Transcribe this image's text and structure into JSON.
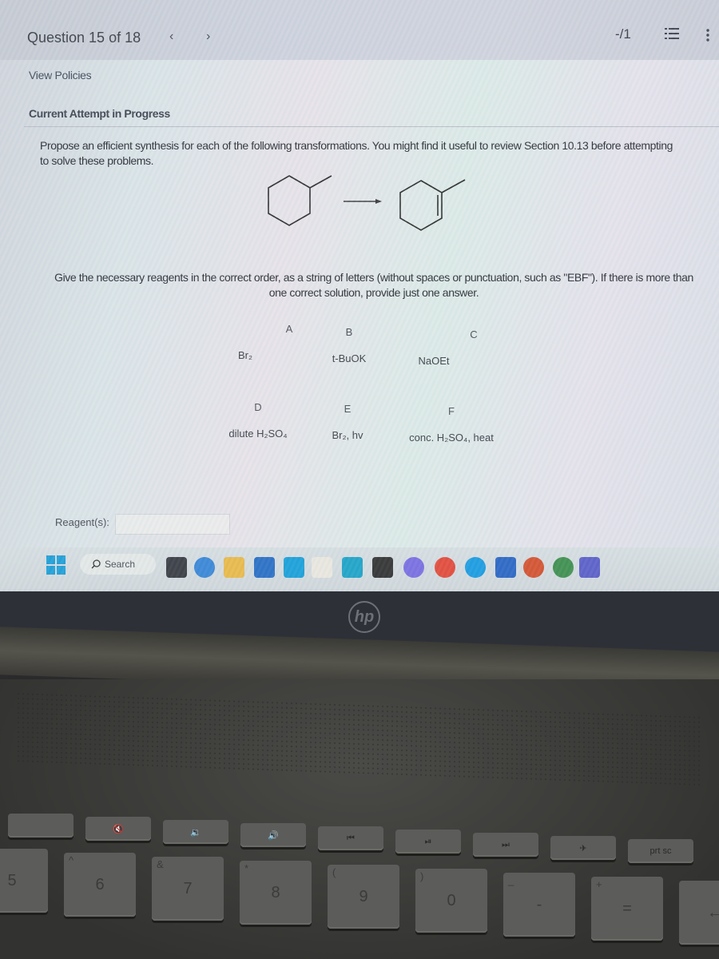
{
  "header": {
    "question_label": "Question 15 of 18",
    "prev_icon": "‹",
    "next_icon": "›",
    "score": "-/1",
    "list_icon": "list-icon",
    "more_icon": "more-vertical-icon"
  },
  "links": {
    "view_policies": "View Policies"
  },
  "status": {
    "attempt": "Current Attempt in Progress"
  },
  "question": {
    "prompt": "Propose an efficient synthesis for each of the following transformations. You might find it useful to review Section 10.13 before attempting to solve these problems.",
    "reaction": {
      "reactant": "methylcyclohexane",
      "product": "1-methylcyclohexene",
      "arrow": "→"
    },
    "instructions": "Give the necessary reagents in the correct order, as a string of letters (without spaces or punctuation, such as \"EBF\"). If there is more than one correct solution, provide just one answer.",
    "reagents": [
      {
        "letter": "A",
        "name": "Br₂"
      },
      {
        "letter": "B",
        "name": "t-BuOK"
      },
      {
        "letter": "C",
        "name": "NaOEt"
      },
      {
        "letter": "D",
        "name": "dilute H₂SO₄"
      },
      {
        "letter": "E",
        "name": "Br₂, hv"
      },
      {
        "letter": "F",
        "name": "conc. H₂SO₄, heat"
      }
    ],
    "answer_label": "Reagent(s):",
    "answer_value": ""
  },
  "taskbar": {
    "search_label": "Search",
    "apps": [
      {
        "name": "task-view",
        "color": "#3a3d44"
      },
      {
        "name": "meet",
        "color": "#3a86d6"
      },
      {
        "name": "file-explorer",
        "color": "#e8b84a"
      },
      {
        "name": "microsoft-store",
        "color": "#2a6fc4"
      },
      {
        "name": "mail",
        "color": "#1aa0d8"
      },
      {
        "name": "amazon",
        "color": "#e9e6de"
      },
      {
        "name": "mcgraw-hill",
        "color": "#1fa3c7"
      },
      {
        "name": "dropbox",
        "color": "#333333"
      },
      {
        "name": "copilot",
        "color": "#7a6ee0"
      },
      {
        "name": "chrome",
        "color": "#e14b3b"
      },
      {
        "name": "edge",
        "color": "#1b9be0"
      },
      {
        "name": "word",
        "color": "#2b66c3"
      },
      {
        "name": "powerpoint",
        "color": "#d35230"
      },
      {
        "name": "cd-app",
        "color": "#3f8f4f"
      },
      {
        "name": "teams",
        "color": "#5b5fc7"
      }
    ]
  },
  "laptop": {
    "brand": "hp",
    "fn_keys": [
      "",
      "mute",
      "vol-down",
      "vol-up",
      "prev-track",
      "play-pause",
      "next-track",
      "airplane",
      "prt sc"
    ],
    "number_keys": [
      {
        "main": "5",
        "shift": "%"
      },
      {
        "main": "6",
        "shift": "^"
      },
      {
        "main": "7",
        "shift": "&"
      },
      {
        "main": "8",
        "shift": "*"
      },
      {
        "main": "9",
        "shift": "("
      },
      {
        "main": "0",
        "shift": ")"
      },
      {
        "main": "-",
        "shift": "_"
      },
      {
        "main": "=",
        "shift": "+"
      },
      {
        "main": "←",
        "shift": ""
      }
    ]
  }
}
